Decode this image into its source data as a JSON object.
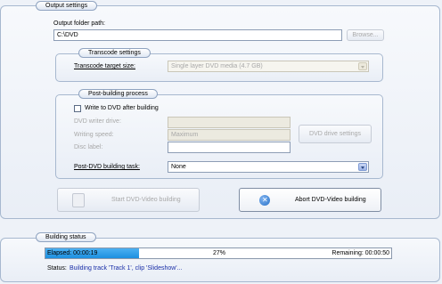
{
  "output_settings": {
    "title": "Output settings",
    "folder_label": "Output folder path:",
    "folder_value": "C:\\DVD",
    "browse_label": "Browse..."
  },
  "transcode_settings": {
    "title": "Transcode settings",
    "target_label": "Transcode target size:",
    "target_value": "Single layer DVD media (4.7 GB)"
  },
  "post_building": {
    "title": "Post-building process",
    "write_label": "Write to DVD after building",
    "write_checked": false,
    "writer_label": "DVD writer drive:",
    "writer_value": "",
    "speed_label": "Writing speed:",
    "speed_value": "Maximum",
    "disc_label": "Disc label:",
    "disc_value": "",
    "drive_settings_label": "DVD drive settings",
    "task_label": "Post-DVD building task:",
    "task_value": "None"
  },
  "actions": {
    "start_label": "Start DVD-Video building",
    "abort_label": "Abort DVD-Video building"
  },
  "building_status": {
    "title": "Building status",
    "elapsed": "Elapsed: 00:00:19",
    "percent_text": "27%",
    "progress_fraction": 0.27,
    "remaining": "Remaining: 00:00:50",
    "status_label": "Status:",
    "status_text": "Building track 'Track 1', clip 'Slideshow'..."
  },
  "colors": {
    "accent": "#1c8fe0",
    "status_text": "#1a2fa8",
    "abort_icon": "#2a72c8"
  }
}
